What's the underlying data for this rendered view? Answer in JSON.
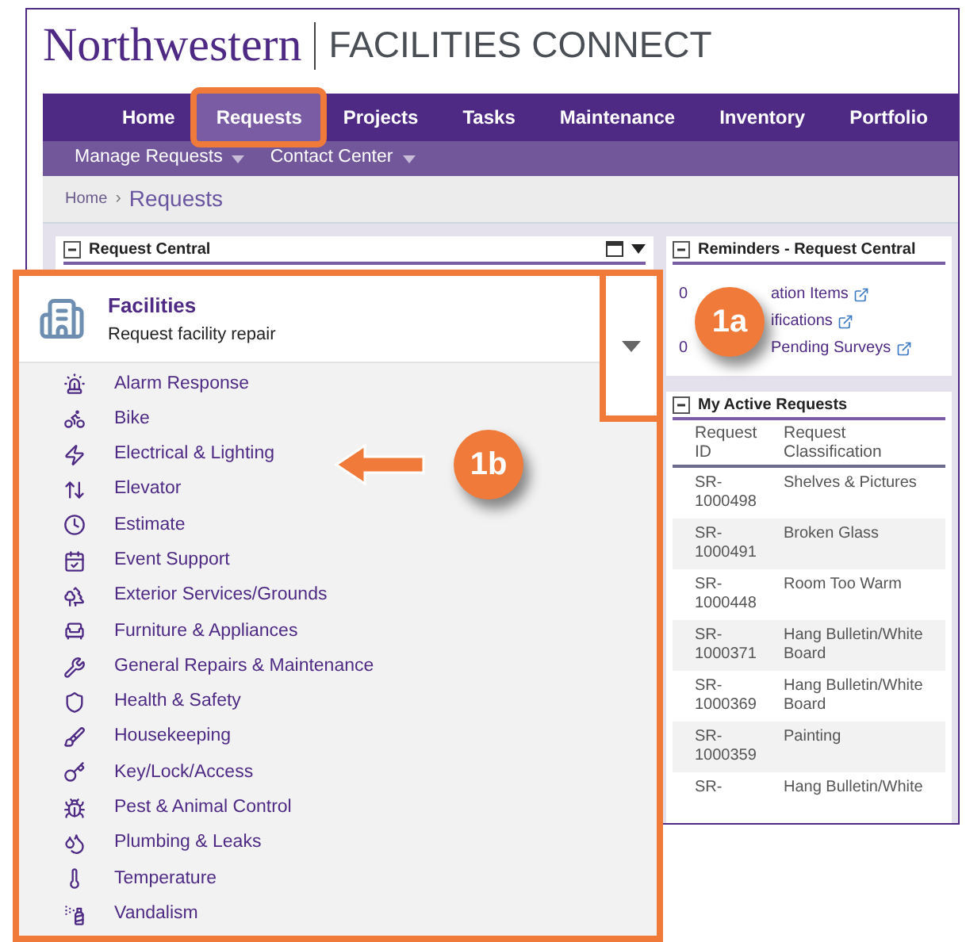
{
  "header": {
    "logo": "Northwestern",
    "app_name": "FACILITIES CONNECT"
  },
  "nav": [
    {
      "label": "Home",
      "selected": false
    },
    {
      "label": "Requests",
      "selected": true
    },
    {
      "label": "Projects",
      "selected": false
    },
    {
      "label": "Tasks",
      "selected": false
    },
    {
      "label": "Maintenance",
      "selected": false
    },
    {
      "label": "Inventory",
      "selected": false
    },
    {
      "label": "Portfolio",
      "selected": false
    }
  ],
  "subnav": [
    {
      "label": "Manage Requests"
    },
    {
      "label": "Contact Center"
    }
  ],
  "breadcrumb": {
    "home": "Home",
    "separator": "›",
    "current": "Requests"
  },
  "request_central": {
    "title": "Request Central"
  },
  "reminders": {
    "title": "Reminders - Request Central",
    "items": [
      {
        "lead": "0",
        "text": "ation Items"
      },
      {
        "text": "ifications"
      },
      {
        "lead": "0",
        "text": "Pending Surveys"
      }
    ]
  },
  "active_requests": {
    "title": "My Active Requests",
    "columns": [
      "Request ID",
      "Request Classification"
    ],
    "rows": [
      {
        "id": "SR-1000498",
        "classification": "Shelves & Pictures"
      },
      {
        "id": "SR-1000491",
        "classification": "Broken Glass"
      },
      {
        "id": "SR-1000448",
        "classification": "Room Too Warm"
      },
      {
        "id": "SR-1000371",
        "classification": "Hang Bulletin/White Board"
      },
      {
        "id": "SR-1000369",
        "classification": "Hang Bulletin/White Board"
      },
      {
        "id": "SR-1000359",
        "classification": "Painting"
      },
      {
        "id": "SR-",
        "classification": "Hang Bulletin/White"
      }
    ]
  },
  "dropdown": {
    "title": "Facilities",
    "subtitle": "Request facility repair",
    "expanded": true,
    "items": [
      {
        "label": "Alarm Response"
      },
      {
        "label": "Bike"
      },
      {
        "label": "Electrical & Lighting"
      },
      {
        "label": "Elevator"
      },
      {
        "label": "Estimate"
      },
      {
        "label": "Event Support"
      },
      {
        "label": "Exterior Services/Grounds"
      },
      {
        "label": "Furniture & Appliances"
      },
      {
        "label": "General Repairs & Maintenance"
      },
      {
        "label": "Health & Safety"
      },
      {
        "label": "Housekeeping"
      },
      {
        "label": "Key/Lock/Access"
      },
      {
        "label": "Pest & Animal Control"
      },
      {
        "label": "Plumbing & Leaks"
      },
      {
        "label": "Temperature"
      },
      {
        "label": "Vandalism"
      }
    ]
  },
  "callouts": [
    {
      "label": "1a"
    },
    {
      "label": "1b"
    }
  ]
}
